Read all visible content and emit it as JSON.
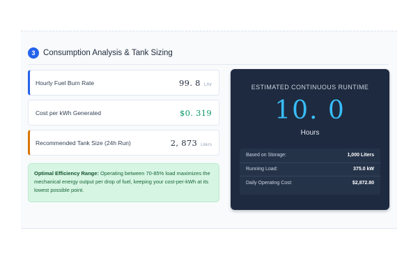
{
  "section": {
    "step_number": "3",
    "title": "Consumption Analysis & Tank Sizing"
  },
  "metrics": [
    {
      "label": "Hourly Fuel Burn Rate",
      "value": "99. 8",
      "unit": "L/hr",
      "accent": "#2563eb"
    },
    {
      "label": "Cost per kWh Generated",
      "value": "$0. 319",
      "unit": "",
      "value_color": "#059669"
    },
    {
      "label": "Recommended Tank Size (24h Run)",
      "value": "2, 873",
      "unit": "Liters",
      "accent": "#d97706"
    }
  ],
  "tip": {
    "title": "Optimal Efficiency Range:",
    "text": " Operating between 70-85% load maximizes the mechanical energy output per drop of fuel, keeping your cost-per-kWh at its lowest possible point."
  },
  "runtime": {
    "title": "ESTIMATED CONTINUOUS RUNTIME",
    "value": "10. 0",
    "unit": "Hours",
    "details": [
      {
        "label": "Based on Storage:",
        "value": "1,000 Liters"
      },
      {
        "label": "Running Load:",
        "value": "375.0 kW"
      },
      {
        "label": "Daily Operating Cost:",
        "value": "$2,872.80"
      }
    ]
  },
  "colors": {
    "accent_blue": "#2563eb",
    "accent_orange": "#d97706",
    "cost_green": "#059669",
    "runtime_value": "#38bdf8",
    "card_background": "#1e2a3f",
    "tip_background": "#d6f5e3"
  }
}
